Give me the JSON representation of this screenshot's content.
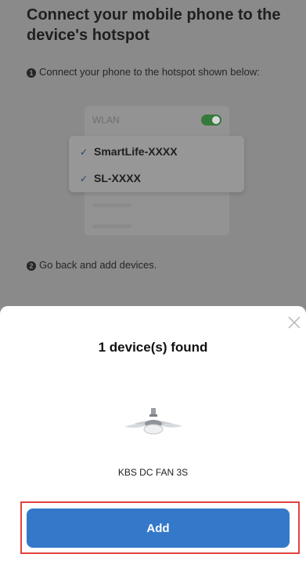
{
  "guide": {
    "title": "Connect your mobile phone to the device's hotspot",
    "step1_number": "1",
    "step1_text": "Connect your phone to the hotspot shown below:",
    "wlan_label": "WLAN",
    "wlan_toggle_on": true,
    "ssid_options": [
      "SmartLife-XXXX",
      "SL-XXXX"
    ],
    "check_glyph": "✓",
    "step2_number": "2",
    "step2_text": "Go back and add devices."
  },
  "sheet": {
    "title": "1 device(s) found",
    "device_name": "KBS DC FAN 3S",
    "device_icon": "ceiling-fan-image",
    "add_label": "Add",
    "close_icon": "close-icon"
  },
  "colors": {
    "overlay": "#8a8a8a",
    "primary_button": "#3479c9",
    "highlight_border": "#e2433f",
    "toggle_on": "#357a3a"
  }
}
